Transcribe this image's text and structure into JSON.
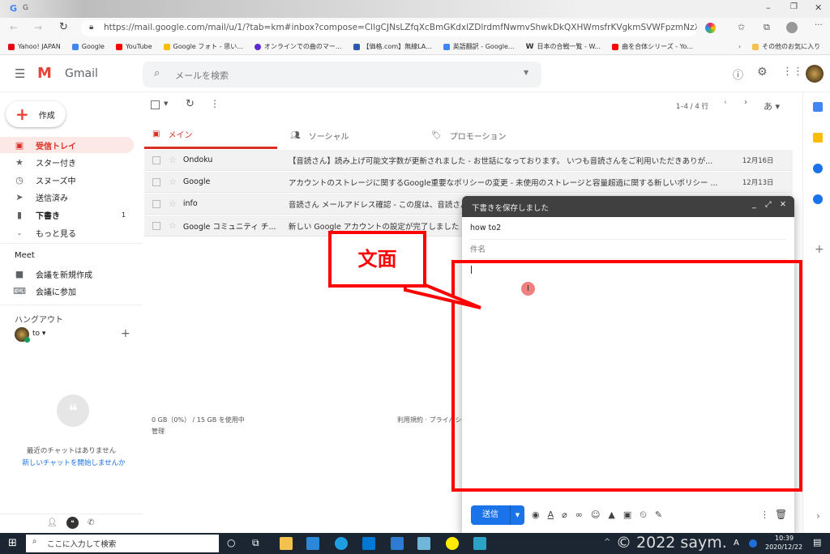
{
  "browser": {
    "tab_title": "G",
    "url": "https://mail.google.com/mail/u/1/?tab=km#inbox?compose=CllgCJNsLZfqXcBmGKdxlZDlrdmfNwmvShwkDkQXHWmsfrKVgkmSVWFpzmNzXZ...",
    "bookmarks": [
      {
        "label": "Yahoo! JAPAN",
        "color": "#e60012"
      },
      {
        "label": "Google",
        "color": "#4285f4"
      },
      {
        "label": "YouTube",
        "color": "#ff0000"
      },
      {
        "label": "Google フォト - 思い...",
        "color": "#fbbc04"
      },
      {
        "label": "オンラインでの曲のマー...",
        "color": "#5b2bd6"
      },
      {
        "label": "【価格.com】無線LA...",
        "color": "#2a5caa"
      },
      {
        "label": "英語翻訳 - Google...",
        "color": "#4285f4"
      },
      {
        "label": "日本の合戦一覧 - W...",
        "color": "#333333"
      },
      {
        "label": "曲を合体シリーズ - Yo...",
        "color": "#ff0000"
      }
    ],
    "other_favorites": "その他のお気に入り"
  },
  "gmail": {
    "logo": "Gmail",
    "search_placeholder": "メールを検索",
    "compose": "作成",
    "sidebar": [
      {
        "label": "受信トレイ",
        "icon": "inbox-icon",
        "active": true
      },
      {
        "label": "スター付き",
        "icon": "star-icon"
      },
      {
        "label": "スヌーズ中",
        "icon": "clock-icon"
      },
      {
        "label": "送信済み",
        "icon": "send-icon"
      },
      {
        "label": "下書き",
        "icon": "draft-icon",
        "count": "1"
      },
      {
        "label": "もっと見る",
        "icon": "chevron-down-icon"
      }
    ],
    "meet": {
      "title": "Meet",
      "items": [
        "会議を新規作成",
        "会議に参加"
      ]
    },
    "hangouts": {
      "title": "ハングアウト",
      "user": "to",
      "empty": "最近のチャットはありません",
      "start": "新しいチャットを開始しませんか"
    },
    "toolbar": {
      "count": "1–4 / 4 行",
      "ime": "あ"
    },
    "tabs": [
      "メイン",
      "ソーシャル",
      "プロモーション"
    ],
    "emails": [
      {
        "from": "Ondoku",
        "subject": "【音読さん】読み上げ可能文字数が更新されました - お世話になっております。 いつも音読さんをご利用いただきありが...",
        "date": "12月16日"
      },
      {
        "from": "Google",
        "subject": "アカウントのストレージに関するGoogle重要なポリシーの変更 - 未使用のストレージと容量超過に関する新しいポリシー ...",
        "date": "12月13日"
      },
      {
        "from": "info",
        "subject": "音読さん メールアドレス確認 - この度は、音読さん",
        "date": ""
      },
      {
        "from": "Google コミュニティ チ...",
        "subject": "新しい Google アカウントの設定が完了しました",
        "date": ""
      }
    ],
    "storage": "0 GB（0%） / 15 GB を使用中",
    "manage": "管理",
    "terms": "利用規約 · プライバシー",
    "compose_window": {
      "title": "下書きを保存しました",
      "to": "how to2",
      "subject_placeholder": "件名",
      "send": "送信"
    }
  },
  "annotation": {
    "label": "文面",
    "color": "#ff0000"
  },
  "taskbar": {
    "search": "ここに入力して検索",
    "time": "10:39",
    "date": "2020/12/22",
    "watermark": "© 2022 saym.",
    "ime": "A"
  }
}
